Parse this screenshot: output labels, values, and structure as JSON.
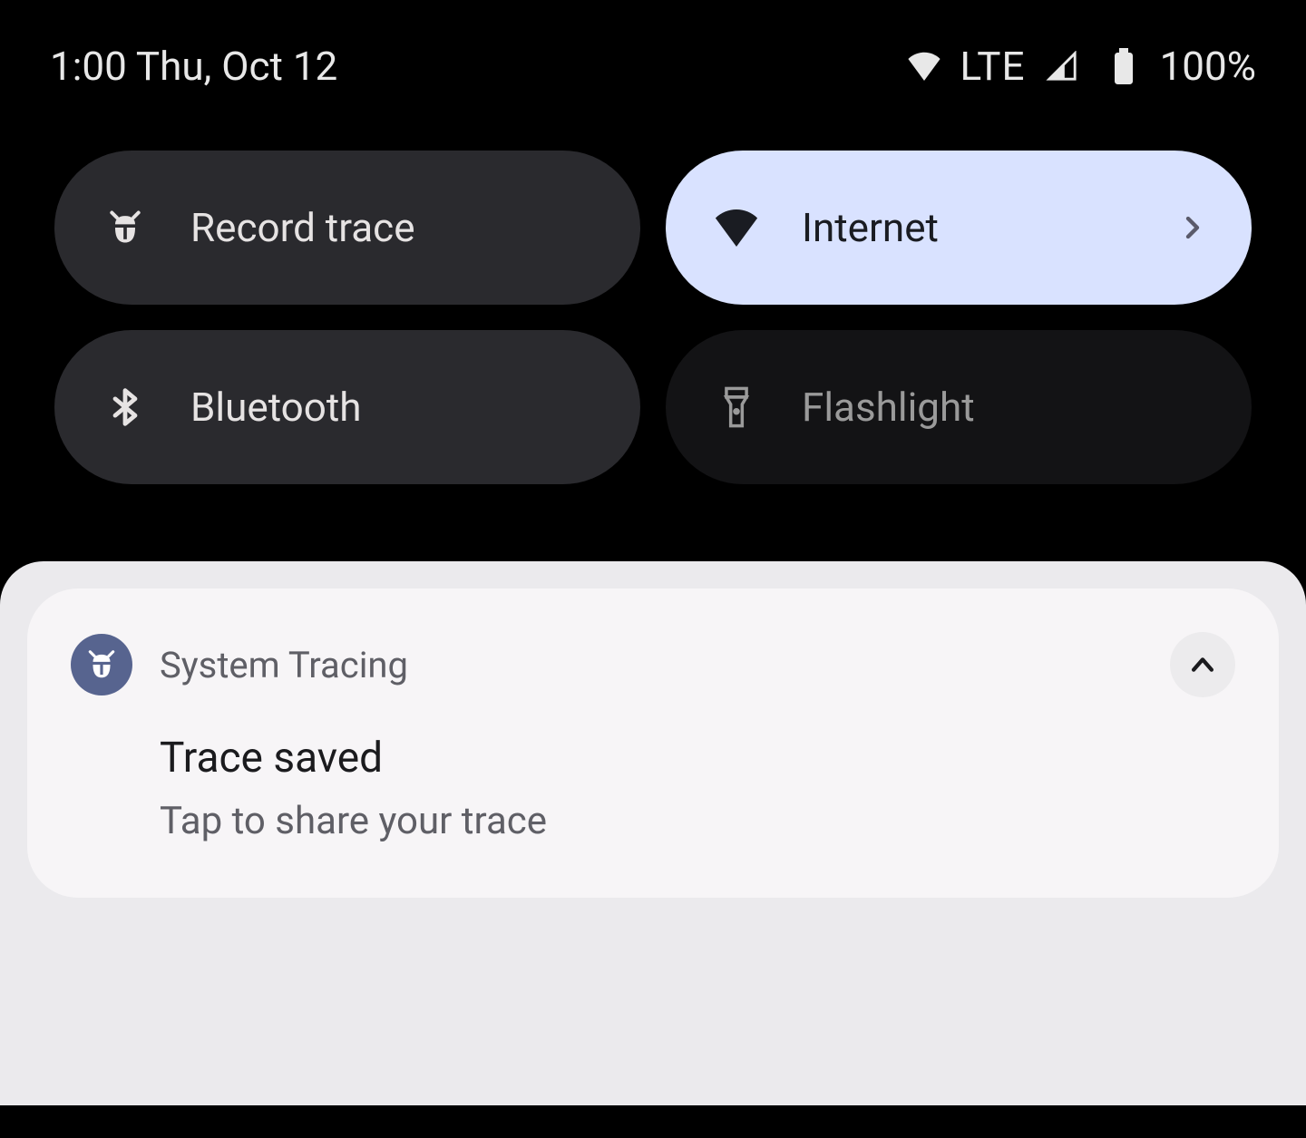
{
  "status": {
    "time_date": "1:00 Thu, Oct 12",
    "network": "LTE",
    "battery": "100%"
  },
  "tiles": {
    "record_trace": {
      "label": "Record trace"
    },
    "internet": {
      "label": "Internet"
    },
    "bluetooth": {
      "label": "Bluetooth"
    },
    "flashlight": {
      "label": "Flashlight"
    }
  },
  "notification": {
    "app": "System Tracing",
    "title": "Trace saved",
    "text": "Tap to share your trace"
  }
}
